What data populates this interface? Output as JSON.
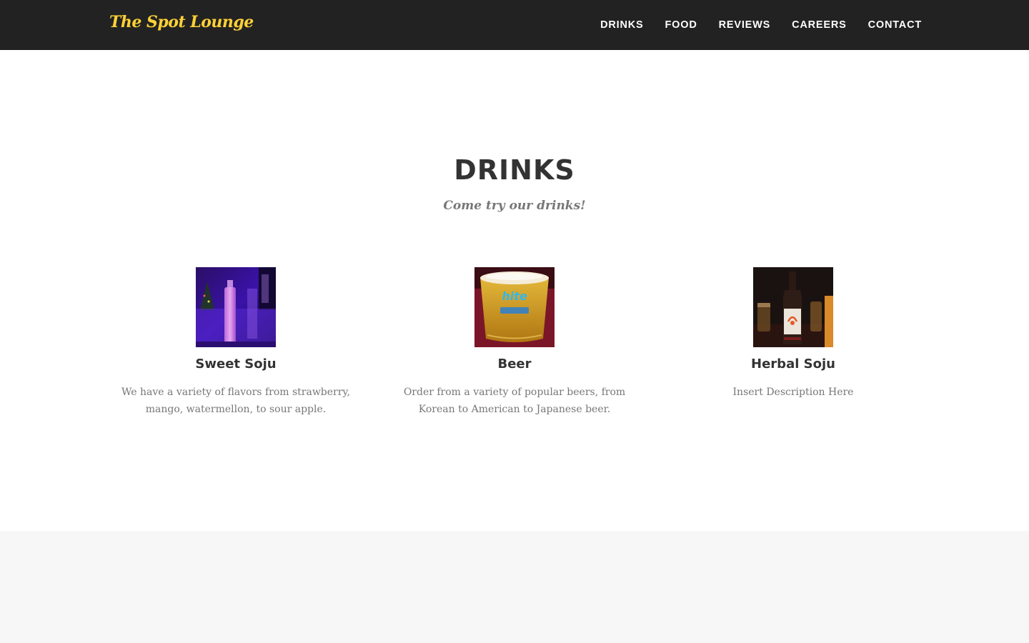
{
  "nav": {
    "brand": "The Spot Lounge",
    "links": [
      "DRINKS",
      "FOOD",
      "REVIEWS",
      "CAREERS",
      "CONTACT"
    ]
  },
  "drinks": {
    "heading": "DRINKS",
    "subheading": "Come try our drinks!",
    "items": [
      {
        "title": "Sweet Soju",
        "description": "We have a variety of flavors from strawberry, mango, watermellon, to sour apple."
      },
      {
        "title": "Beer",
        "description": "Order from a variety of popular beers, from Korean to American to Japanese beer."
      },
      {
        "title": "Herbal Soju",
        "description": "Insert Description Here"
      }
    ]
  },
  "colors": {
    "navbar": "#222222",
    "brand": "#fed136",
    "heading": "#333333",
    "muted": "#777777",
    "alt_section": "#f7f7f7"
  }
}
